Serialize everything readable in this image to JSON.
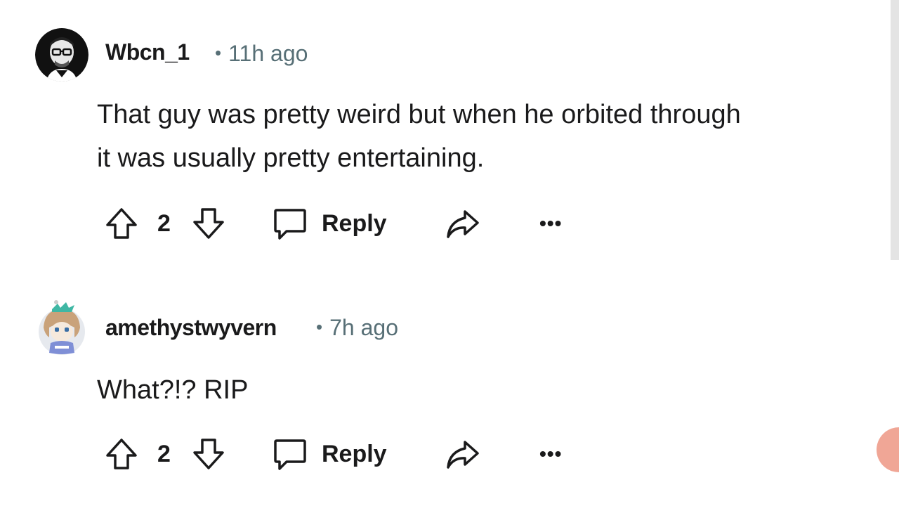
{
  "comments": [
    {
      "author": "Wbcn_1",
      "separator": "•",
      "time": "11h ago",
      "line1": "That guy was pretty weird but when he orbited through",
      "line2": "it was usually pretty entertaining.",
      "score": "2",
      "reply_label": "Reply",
      "more_label": "•••"
    },
    {
      "author": "amethystwyvern",
      "separator": "•",
      "time": "7h ago",
      "line1": "What?!? RIP",
      "score": "2",
      "reply_label": "Reply",
      "more_label": "•••"
    }
  ],
  "icons": {
    "upvote": "arrow-up-icon",
    "downvote": "arrow-down-icon",
    "reply": "speech-bubble-icon",
    "share": "share-arrow-icon",
    "more": "ellipsis-icon"
  },
  "colors": {
    "text": "#1a1a1b",
    "meta": "#576f76",
    "fab": "#f0a696"
  }
}
